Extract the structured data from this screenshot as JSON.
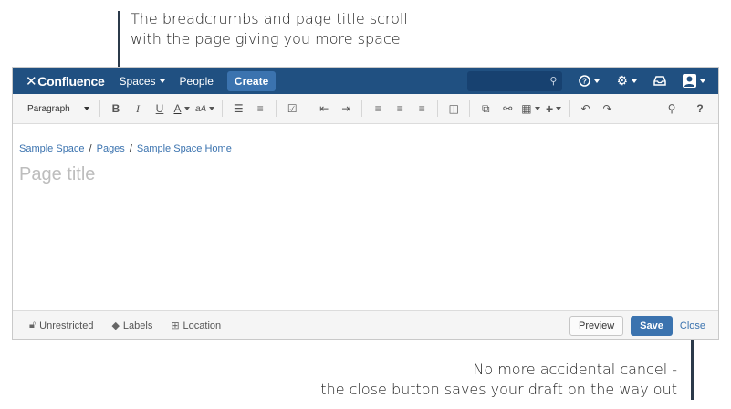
{
  "callouts": {
    "top": {
      "line1": "The breadcrumbs and page title scroll",
      "line2": "with the page giving you more space"
    },
    "bottom": {
      "line1": "No more accidental cancel -",
      "line2": "the close button saves your draft on the way out"
    }
  },
  "topnav": {
    "logo_text": "Confluence",
    "logo_icon": "confluence-x-icon",
    "spaces_label": "Spaces",
    "people_label": "People",
    "create_label": "Create",
    "search_placeholder": "",
    "icons": [
      "search-icon",
      "help-icon",
      "gear-icon",
      "notifications-tray-icon",
      "user-avatar-icon"
    ],
    "colors": {
      "bar": "#205081",
      "create": "#3b73af"
    }
  },
  "toolbar": {
    "paragraph_label": "Paragraph",
    "bold": "B",
    "italic": "I",
    "underline": "U",
    "text_color": "A",
    "more_formatting": "aA",
    "help": "?"
  },
  "content": {
    "breadcrumbs": [
      "Sample Space",
      "Pages",
      "Sample Space Home"
    ],
    "separator": "/",
    "title_placeholder": "Page title"
  },
  "footer": {
    "restriction_label": "Unrestricted",
    "labels_label": "Labels",
    "location_label": "Location",
    "preview_label": "Preview",
    "save_label": "Save",
    "close_label": "Close"
  }
}
